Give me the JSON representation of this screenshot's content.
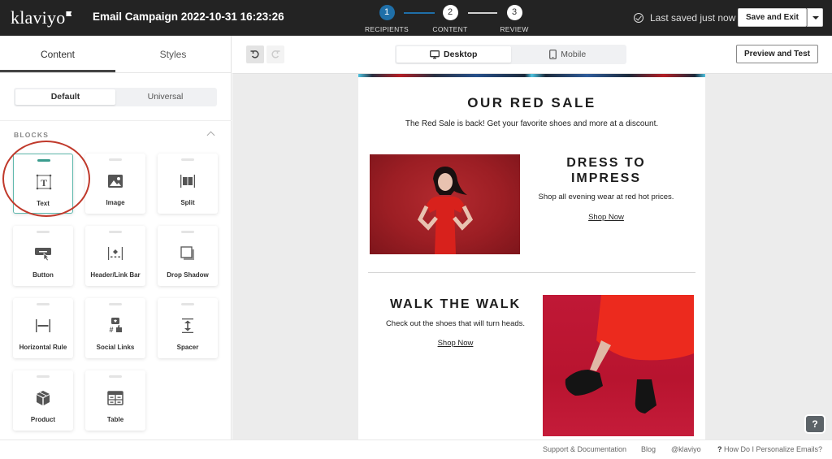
{
  "app": {
    "logo": "klaviyo",
    "campaign_title": "Email Campaign 2022-10-31 16:23:26"
  },
  "steps": [
    {
      "number": "1",
      "label": "RECIPIENTS",
      "state": "active"
    },
    {
      "number": "2",
      "label": "CONTENT",
      "state": "current"
    },
    {
      "number": "3",
      "label": "REVIEW",
      "state": "upcoming"
    }
  ],
  "header": {
    "saved_status": "Last saved just now",
    "save_exit_label": "Save and Exit"
  },
  "sidebar": {
    "tabs": [
      {
        "label": "Content",
        "active": true
      },
      {
        "label": "Styles",
        "active": false
      }
    ],
    "segment": [
      {
        "label": "Default",
        "active": true
      },
      {
        "label": "Universal",
        "active": false
      }
    ],
    "blocks_heading": "BLOCKS",
    "blocks": [
      {
        "label": "Text",
        "icon": "text-icon",
        "selected": true
      },
      {
        "label": "Image",
        "icon": "image-icon"
      },
      {
        "label": "Split",
        "icon": "split-icon"
      },
      {
        "label": "Button",
        "icon": "button-icon"
      },
      {
        "label": "Header/Link Bar",
        "icon": "header-link-bar-icon"
      },
      {
        "label": "Drop Shadow",
        "icon": "drop-shadow-icon"
      },
      {
        "label": "Horizontal Rule",
        "icon": "horizontal-rule-icon"
      },
      {
        "label": "Social Links",
        "icon": "social-links-icon"
      },
      {
        "label": "Spacer",
        "icon": "spacer-icon"
      },
      {
        "label": "Product",
        "icon": "product-icon"
      },
      {
        "label": "Table",
        "icon": "table-icon"
      }
    ]
  },
  "toolbar": {
    "views": [
      {
        "label": "Desktop",
        "icon": "desktop-icon",
        "active": true
      },
      {
        "label": "Mobile",
        "icon": "mobile-icon",
        "active": false
      }
    ],
    "preview_label": "Preview and Test"
  },
  "email": {
    "title": "OUR RED SALE",
    "subtitle": "The Red Sale is back! Get your favorite shoes and more at a discount.",
    "section1": {
      "heading_line1": "DRESS TO",
      "heading_line2": "IMPRESS",
      "text": "Shop all evening wear at red hot prices.",
      "link": "Shop Now"
    },
    "section2": {
      "heading": "WALK THE WALK",
      "text": "Check out the shoes that will turn heads.",
      "link": "Shop Now"
    }
  },
  "help_button": "?",
  "footer": {
    "links": [
      "Support & Documentation",
      "Blog",
      "@klaviyo"
    ],
    "help_link": "How Do I Personalize Emails?",
    "help_prefix": "?"
  },
  "colors": {
    "topbar": "#232323",
    "step_active": "#1f6fa8",
    "selected_block": "#3a9c8e",
    "highlight_ring": "#c0392b"
  }
}
